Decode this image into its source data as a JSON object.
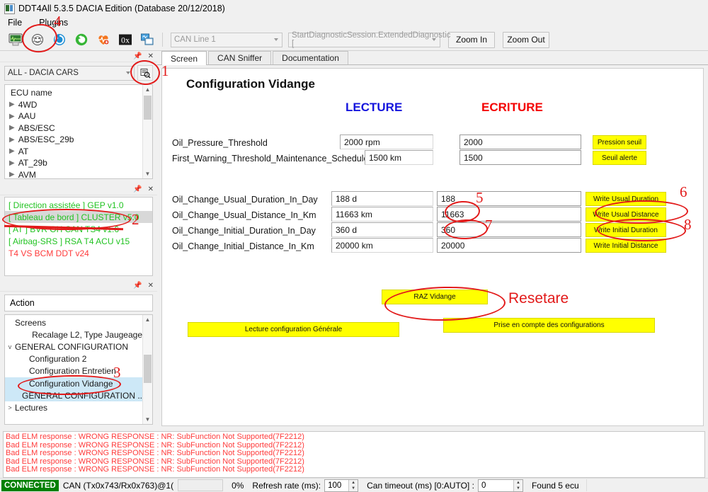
{
  "window": {
    "title": "DDT4All 5.3.5 DACIA Edition (Database 20/12/2018)",
    "icon": "app-icon"
  },
  "menubar": {
    "items": [
      {
        "label": "File"
      },
      {
        "label": "Plugins"
      }
    ]
  },
  "toolbar": {
    "buttons": [
      {
        "name": "ecu-screen-icon"
      },
      {
        "name": "vehicle-scan-icon"
      },
      {
        "name": "refresh-blue-icon"
      },
      {
        "name": "connect-green-icon"
      },
      {
        "name": "heartbeat-icon"
      },
      {
        "name": "hex-0x-icon"
      },
      {
        "name": "copy-screens-icon"
      }
    ],
    "can_line": "CAN Line 1",
    "session": "StartDiagnosticSession.ExtendedDiagnostic [",
    "zoom_in": "Zoom In",
    "zoom_out": "Zoom Out"
  },
  "ecu_panel": {
    "filter_value": "ALL - DACIA CARS",
    "search_icon": "search-database-icon",
    "list_header": "ECU name",
    "items": [
      {
        "label": "4WD"
      },
      {
        "label": "AAU"
      },
      {
        "label": "ABS/ESC"
      },
      {
        "label": "ABS/ESC_29b"
      },
      {
        "label": "AT"
      },
      {
        "label": "AT_29b"
      },
      {
        "label": "AVM"
      }
    ]
  },
  "found_ecus": {
    "items": [
      {
        "label": "[ Direction assistée ] GEP v1.0",
        "color": "#22c322",
        "selected": false
      },
      {
        "label": "[ Tableau de bord ] CLUSTER v5.0",
        "color": "#22c322",
        "selected": true
      },
      {
        "label": "[ AT ] BVR OH CAN TS4 v1.6",
        "color": "#22c322",
        "selected": false
      },
      {
        "label": "[ Airbag-SRS ] RSA T4 ACU v15",
        "color": "#22c322",
        "selected": false
      },
      {
        "label": "T4 VS BCM DDT v24",
        "color": "#ff3b3b",
        "selected": false
      }
    ]
  },
  "action_panel": {
    "title": "Action",
    "tree": [
      {
        "label": "Screens",
        "indent": 0,
        "twisty": "",
        "selected": false
      },
      {
        "label": "Recalage L2, Type Jaugeage",
        "indent": 2,
        "twisty": "",
        "selected": false
      },
      {
        "label": "GENERAL CONFIGURATION",
        "indent": 1,
        "twisty": "v",
        "selected": false
      },
      {
        "label": "Configuration 2",
        "indent": 2,
        "twisty": "",
        "selected": false
      },
      {
        "label": "Configuration Entretien",
        "indent": 2,
        "twisty": "",
        "selected": false
      },
      {
        "label": "Configuration Vidange",
        "indent": 2,
        "twisty": "",
        "selected": true
      },
      {
        "label": "GENERAL CONFIGURATION ...",
        "indent": 2,
        "twisty": "",
        "selected": true
      },
      {
        "label": "Lectures",
        "indent": 0,
        "twisty": ">",
        "selected": false
      }
    ]
  },
  "tabs": [
    {
      "label": "Screen",
      "active": true
    },
    {
      "label": "CAN Sniffer",
      "active": false
    },
    {
      "label": "Documentation",
      "active": false
    }
  ],
  "screen": {
    "title": "Configuration Vidange",
    "col_read": "LECTURE",
    "col_write": "ECRITURE",
    "read_color": "#1414dd",
    "write_color": "#f40000",
    "rows": [
      {
        "label": "Oil_Pressure_Threshold",
        "read": "2000 rpm",
        "write": "2000",
        "button": "Pression seuil"
      },
      {
        "label": "First_Warning_Threshold_Maintenance_Schedule",
        "read": "1500 km",
        "write": "1500",
        "button": "Seuil alerte"
      },
      {
        "label": "Oil_Change_Usual_Duration_In_Day",
        "read": "188 d",
        "write": "188",
        "button": "Write Usual Duration"
      },
      {
        "label": "Oil_Change_Usual_Distance_In_Km",
        "read": "11663 km",
        "write": "11663",
        "button": "Write Usual Distance"
      },
      {
        "label": "Oil_Change_Initial_Duration_In_Day",
        "read": "360 d",
        "write": "360",
        "button": "Write Initial Duration"
      },
      {
        "label": "Oil_Change_Initial_Distance_In_Km",
        "read": "20000 km",
        "write": "20000",
        "button": "Write Initial Distance"
      }
    ],
    "raz_button": "RAZ Vidange",
    "read_all_button": "Lecture configuration Générale",
    "apply_button": "Prise en compte des configurations"
  },
  "annotations": {
    "color": "#e21a1a",
    "numbers": [
      "1",
      "2",
      "3",
      "4",
      "5",
      "6",
      "7",
      "8"
    ],
    "note": "Resetare"
  },
  "log": {
    "lines": [
      {
        "tag": "Bad ELM response",
        "rest": " : WRONG RESPONSE : NR: SubFunction Not Supported(7F2212)"
      },
      {
        "tag": "Bad ELM response",
        "rest": " : WRONG RESPONSE : NR: SubFunction Not Supported(7F2212)"
      },
      {
        "tag": "Bad ELM response",
        "rest": " : WRONG RESPONSE : NR: SubFunction Not Supported(7F2212)"
      },
      {
        "tag": "Bad ELM response",
        "rest": " : WRONG RESPONSE : NR: SubFunction Not Supported(7F2212)"
      },
      {
        "tag": "Bad ELM response",
        "rest": " : WRONG RESPONSE : NR: SubFunction Not Supported(7F2212)"
      }
    ]
  },
  "statusbar": {
    "connected": "CONNECTED",
    "connection": "CAN (Tx0x743/Rx0x763)@1(",
    "progress": "0%",
    "refresh_label": "Refresh rate (ms):",
    "refresh_value": "100",
    "timeout_label": "Can timeout (ms) [0:AUTO] :",
    "timeout_value": "0",
    "found": "Found 5 ecu",
    "connected_bg": "#008000"
  }
}
